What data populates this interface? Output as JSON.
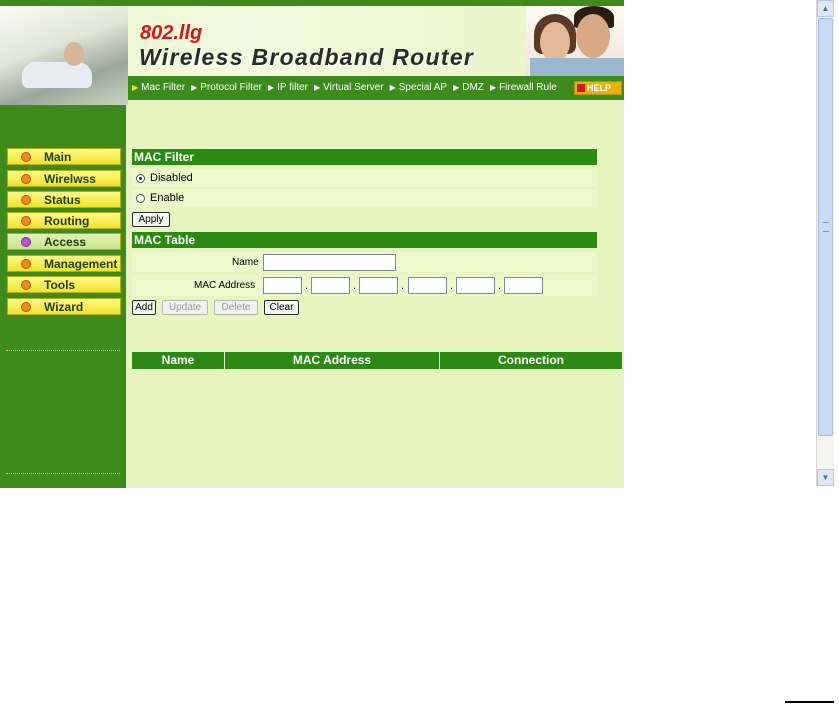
{
  "header": {
    "model": "802.llg",
    "title": "Wireless Broadband Router",
    "help_label": "HELP"
  },
  "nav": {
    "items": [
      {
        "label": "Mac Filter",
        "active": true
      },
      {
        "label": "Protocol Filter",
        "active": false
      },
      {
        "label": "IP filter",
        "active": false
      },
      {
        "label": "Virtual Server",
        "active": false
      },
      {
        "label": "Special AP",
        "active": false
      },
      {
        "label": "DMZ",
        "active": false
      },
      {
        "label": "Firewall Rule",
        "active": false
      }
    ]
  },
  "sidebar": {
    "items": [
      {
        "label": "Main",
        "active": false
      },
      {
        "label": "Wirelwss",
        "active": false
      },
      {
        "label": "Status",
        "active": false
      },
      {
        "label": "Routing",
        "active": false
      },
      {
        "label": "Access",
        "active": true
      },
      {
        "label": "Management",
        "active": false
      },
      {
        "label": "Tools",
        "active": false
      },
      {
        "label": "Wizard",
        "active": false
      }
    ]
  },
  "mac_filter": {
    "header": "MAC Filter",
    "option_disabled": "Disabled",
    "option_enable": "Enable",
    "selected": "Disabled",
    "apply_label": "Apply"
  },
  "mac_table": {
    "header": "MAC Table",
    "name_label": "Name",
    "name_value": "",
    "mac_label": "MAC Address",
    "mac_parts": [
      "",
      "",
      "",
      "",
      "",
      ""
    ],
    "separator": ".",
    "add_label": "Add",
    "update_label": "Update",
    "delete_label": "Delete",
    "clear_label": "Clear",
    "columns": [
      "Name",
      "MAC Address",
      "Connection"
    ],
    "rows": []
  },
  "colors": {
    "dark_green": "#3f8a1c",
    "header_green": "#2c8a14",
    "content_bg": "#e8f5c0",
    "menu_yellow": "#f0e42a"
  }
}
